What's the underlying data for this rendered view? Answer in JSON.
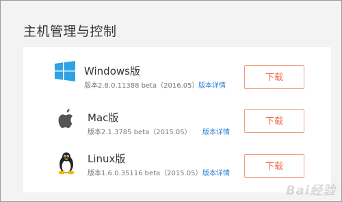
{
  "page": {
    "title": "主机管理与控制"
  },
  "downloads": [
    {
      "name": "Windows版",
      "version": "版本2.8.0.11388 beta（2016.05）",
      "detail": "版本详情",
      "button": "下载",
      "icon": "windows-icon"
    },
    {
      "name": "Mac版",
      "version": "版本2.1.3785 beta（2015.05）",
      "detail": "版本详情",
      "button": "下载",
      "icon": "apple-icon"
    },
    {
      "name": "Linux版",
      "version": "版本1.6.0.35116 beta（2015.05）",
      "detail": "版本详情",
      "button": "下载",
      "icon": "linux-tux-icon"
    }
  ],
  "colors": {
    "accent": "#f26d45",
    "link": "#2f7fd3",
    "windows_blue": "#2ea2e6"
  },
  "watermark": "Bai经验"
}
